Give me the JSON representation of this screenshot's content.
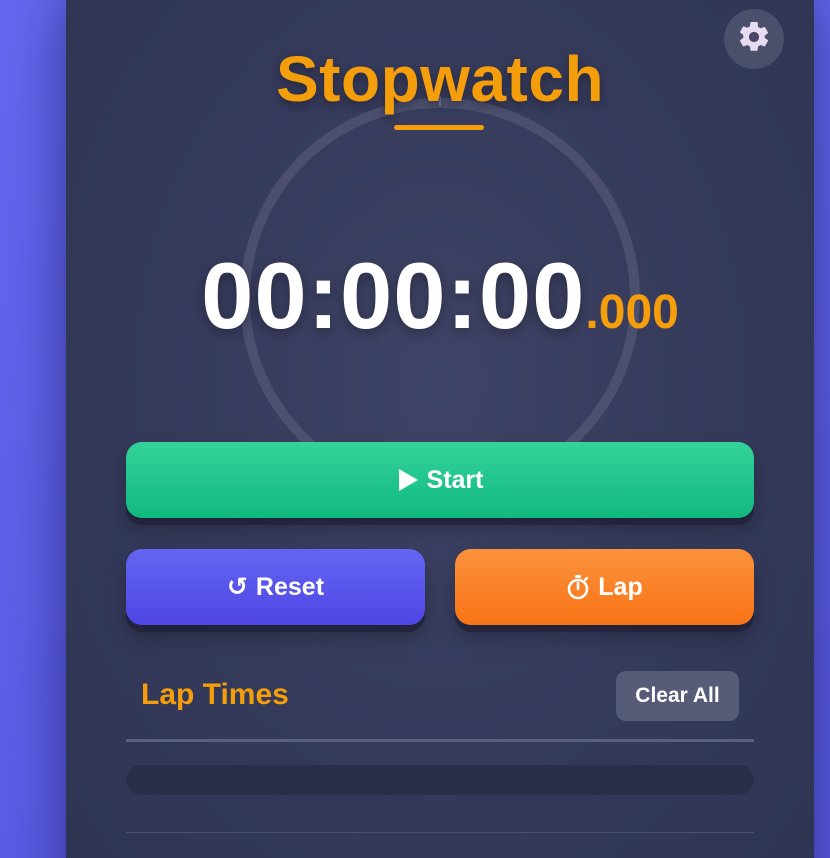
{
  "app": {
    "title": "Stopwatch"
  },
  "display": {
    "time_main": "00:00:00",
    "time_ms": ".000"
  },
  "controls": {
    "start_label": "Start",
    "reset_label": "Reset",
    "reset_icon": "↺",
    "lap_label": "Lap",
    "lap_icon": "⏱"
  },
  "laps": {
    "title": "Lap Times",
    "clear_label": "Clear All",
    "items": []
  },
  "icons": {
    "settings": "gear-icon",
    "start": "play-icon",
    "reset": "reset-icon",
    "lap": "stopwatch-icon"
  },
  "colors": {
    "accent": "#f59e0b",
    "start": "#10b981",
    "reset": "#4f46e5",
    "lap": "#f97316",
    "card": "#363b5c",
    "background": "#6366f1"
  }
}
